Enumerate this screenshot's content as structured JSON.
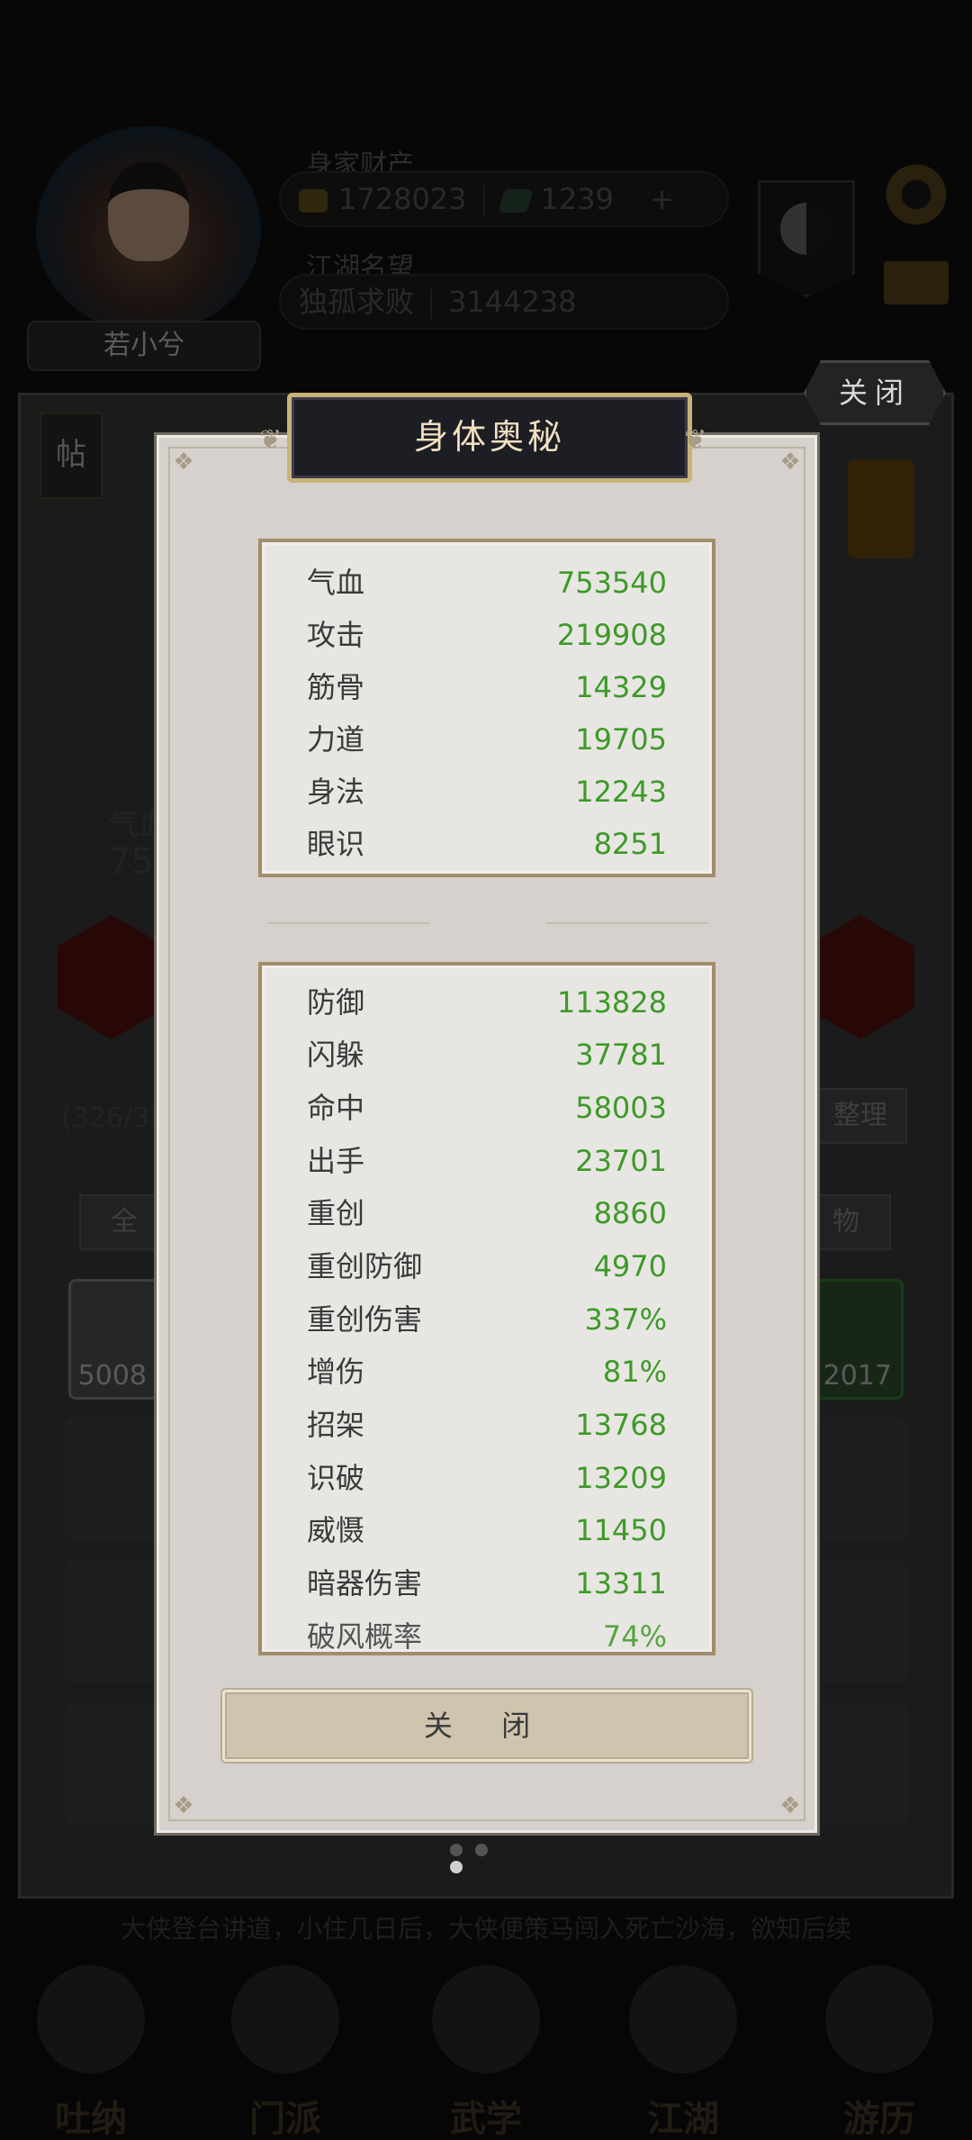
{
  "background": {
    "player_name": "若小兮",
    "wealth_label": "身家财产",
    "silver_amount": "1728023",
    "jade_amount": "1239",
    "plus_symbol": "+",
    "reputation_label": "江湖名望",
    "reputation_title": "独孤求败",
    "reputation_value": "3144238",
    "top_close_label": "关闭",
    "tie_label": "帖",
    "partial_stat_label": "气血",
    "partial_stat_value": "753",
    "bag_count": "(326/35",
    "sort_button": "整理",
    "tab_all": "全",
    "tab_item": "物",
    "slot_left_count": "5008",
    "slot_right_count": "2017",
    "ticker": "大侠登台讲道，小住几日后，大侠便策马闯入死亡沙海，欲知后续"
  },
  "bottom_nav": [
    {
      "label": "吐纳",
      "icon": "meditation-icon"
    },
    {
      "label": "门派",
      "icon": "sect-icon"
    },
    {
      "label": "武学",
      "icon": "martial-arts-icon"
    },
    {
      "label": "江湖",
      "icon": "jianghu-icon"
    },
    {
      "label": "游历",
      "icon": "travel-icon"
    }
  ],
  "modal": {
    "title": "身体奥秘",
    "basic_stats": [
      {
        "label": "气血",
        "value": "753540"
      },
      {
        "label": "攻击",
        "value": "219908"
      },
      {
        "label": "筋骨",
        "value": "14329"
      },
      {
        "label": "力道",
        "value": "19705"
      },
      {
        "label": "身法",
        "value": "12243"
      },
      {
        "label": "眼识",
        "value": "8251"
      }
    ],
    "combat_stats": [
      {
        "label": "防御",
        "value": "113828"
      },
      {
        "label": "闪躲",
        "value": "37781"
      },
      {
        "label": "命中",
        "value": "58003"
      },
      {
        "label": "出手",
        "value": "23701"
      },
      {
        "label": "重创",
        "value": "8860"
      },
      {
        "label": "重创防御",
        "value": "4970"
      },
      {
        "label": "重创伤害",
        "value": "337%"
      },
      {
        "label": "增伤",
        "value": "81%"
      },
      {
        "label": "招架",
        "value": "13768"
      },
      {
        "label": "识破",
        "value": "13209"
      },
      {
        "label": "威慑",
        "value": "11450"
      },
      {
        "label": "暗器伤害",
        "value": "13311"
      },
      {
        "label": "破风概率",
        "value": "74%"
      }
    ],
    "close_label": "关 闭"
  },
  "pagination": {
    "total": 3,
    "active": 3
  }
}
